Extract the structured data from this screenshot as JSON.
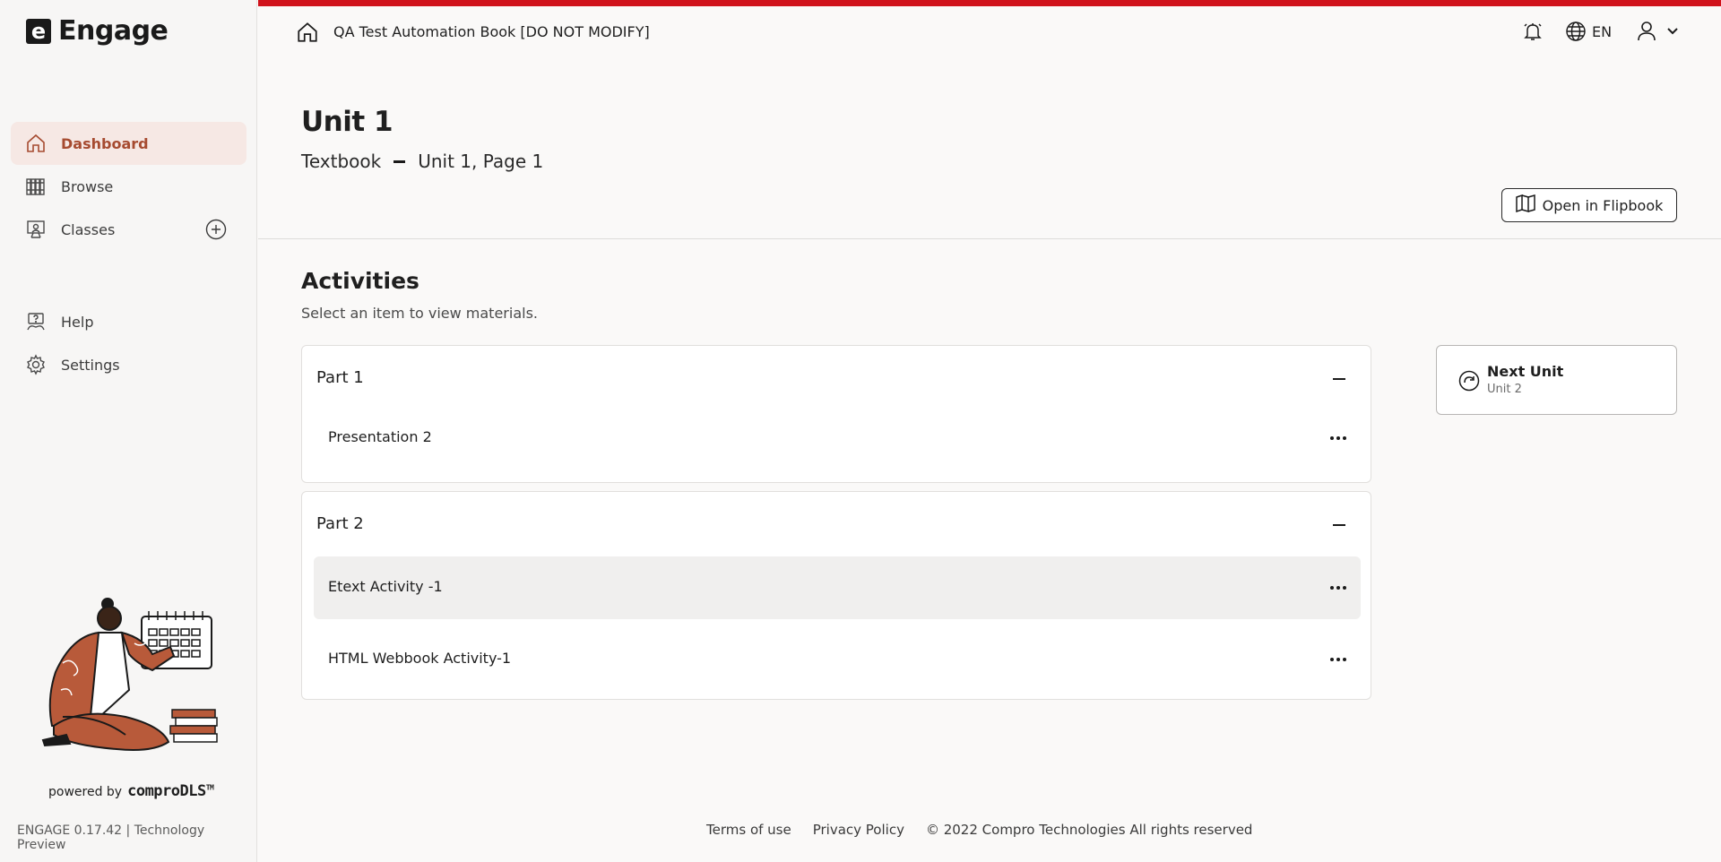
{
  "app": {
    "name": "Engage",
    "logo_letter": "e",
    "accent_color": "#d0121b",
    "active_color": "#a64b30"
  },
  "sidebar": {
    "items": [
      {
        "label": "Dashboard",
        "icon": "home-icon"
      },
      {
        "label": "Browse",
        "icon": "books-icon"
      },
      {
        "label": "Classes",
        "icon": "classroom-icon"
      }
    ],
    "secondary": [
      {
        "label": "Help",
        "icon": "help-icon"
      },
      {
        "label": "Settings",
        "icon": "gear-icon"
      }
    ],
    "powered_by_prefix": "powered by",
    "powered_by_brand": "comproDLS",
    "powered_by_tm": "TM",
    "version": "ENGAGE 0.17.42 | Technology Preview"
  },
  "topbar": {
    "book_title": "QA Test Automation Book [DO NOT MODIFY]",
    "language": "EN"
  },
  "header": {
    "unit_title": "Unit 1",
    "breadcrumb_left": "Textbook",
    "breadcrumb_right": "Unit 1, Page 1",
    "flipbook_button": "Open in Flipbook"
  },
  "activities": {
    "title": "Activities",
    "subtitle": "Select an item to view materials.",
    "parts": [
      {
        "label": "Part 1",
        "items": [
          "Presentation 2"
        ]
      },
      {
        "label": "Part 2",
        "items": [
          "Etext Activity -1",
          "HTML Webbook Activity-1"
        ]
      }
    ]
  },
  "next_unit": {
    "title": "Next Unit",
    "subtitle": "Unit 2"
  },
  "footer": {
    "terms": "Terms of use",
    "privacy": "Privacy Policy",
    "copyright": "© 2022 Compro Technologies All rights reserved"
  }
}
